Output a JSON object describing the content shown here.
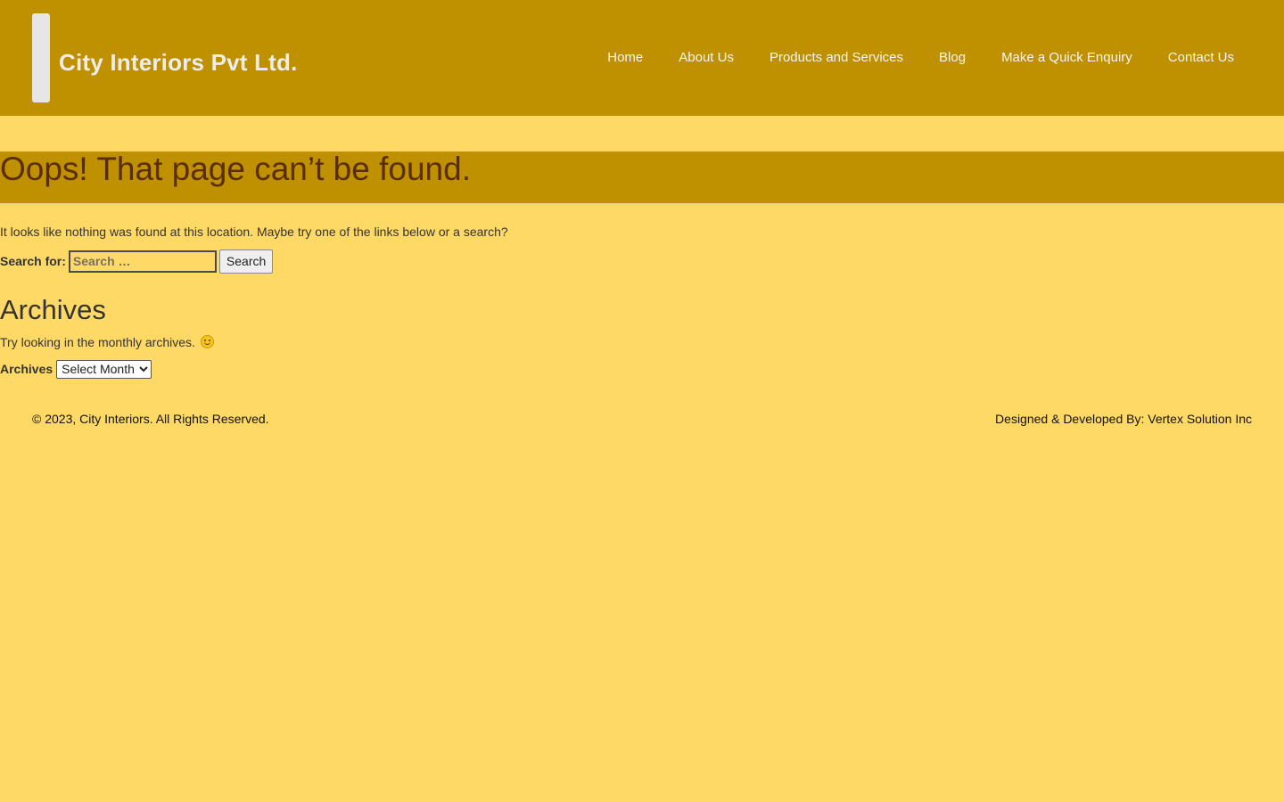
{
  "header": {
    "site_title": "City Interiors Pvt Ltd.",
    "nav": [
      {
        "label": "Home"
      },
      {
        "label": "About Us"
      },
      {
        "label": "Products and Services"
      },
      {
        "label": "Blog"
      },
      {
        "label": "Make a Quick Enquiry"
      },
      {
        "label": "Contact Us"
      }
    ]
  },
  "main": {
    "page_title": "Oops! That page can’t be found.",
    "intro": "It looks like nothing was found at this location. Maybe try one of the links below or a search?",
    "search": {
      "label": "Search for:",
      "placeholder": "Search …",
      "value": "",
      "button_label": "Search"
    },
    "archives": {
      "heading": "Archives",
      "text": "Try looking in the monthly archives.",
      "select_label": "Archives",
      "selected_option": "Select Month"
    }
  },
  "footer": {
    "copyright": "© 2023, City Interiors. All Rights Reserved.",
    "credit": "Designed & Developed By: Vertex Solution Inc"
  },
  "colors": {
    "header_bg": "#BF9000",
    "page_bg": "#FFD966",
    "title_text": "#5A2E05"
  }
}
